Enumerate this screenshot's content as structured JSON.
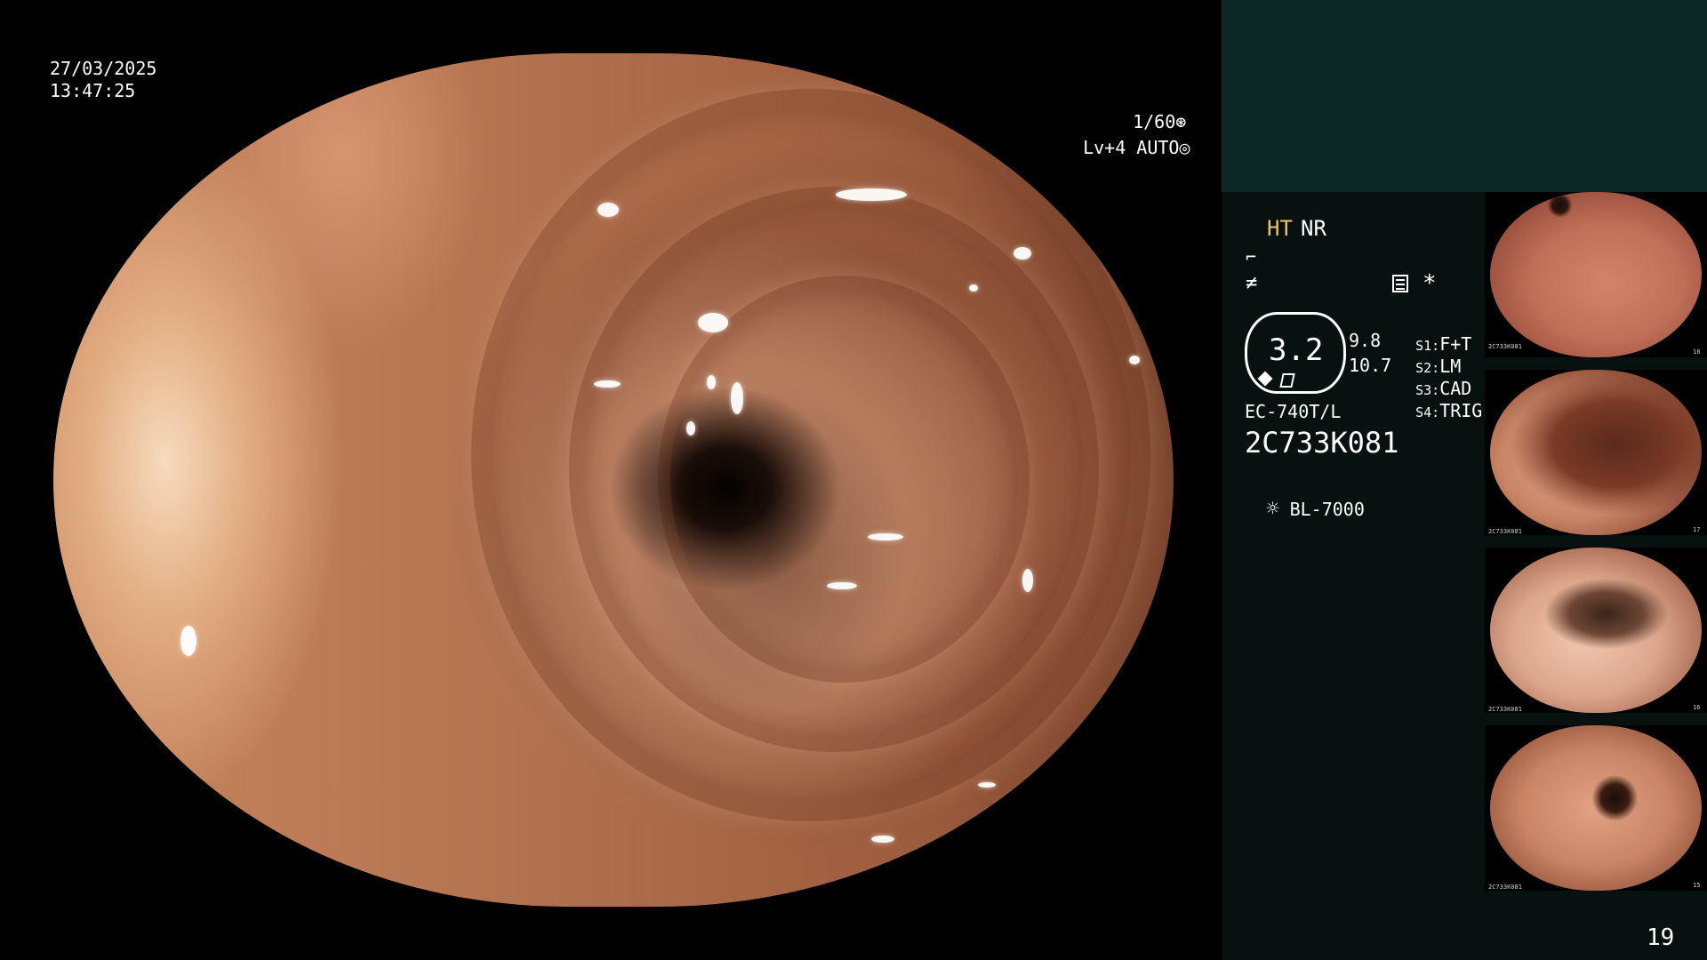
{
  "osd": {
    "date": "27/03/2025",
    "time": "13:47:25",
    "shutter": "1/60",
    "iris": "Lv+4 AUTO"
  },
  "panel": {
    "mode_ht": "HT",
    "mode_nr": "NR",
    "zoom_value": "3.2",
    "value_a": "9.8",
    "value_b": "10.7",
    "s1_key": "S1:",
    "s1_val": "F+T",
    "s2_key": "S2:",
    "s2_val": "LM",
    "s3_key": "S3:",
    "s3_val": "CAD",
    "s4_key": "S4:",
    "s4_val": "TRIG",
    "star": "*",
    "scope_model": "EC-740T/L",
    "serial": "2C733K081",
    "light_source": "BL-7000",
    "page_number": "19"
  },
  "thumbnails": [
    {
      "index": "18",
      "serial": "2C733K081"
    },
    {
      "index": "17",
      "serial": "2C733K081"
    },
    {
      "index": "16",
      "serial": "2C733K081"
    },
    {
      "index": "15",
      "serial": "2C733K081"
    }
  ],
  "colors": {
    "panel_top_bg": "#0b2723",
    "panel_bg": "#07110f",
    "ht_accent": "#f2c26a"
  }
}
